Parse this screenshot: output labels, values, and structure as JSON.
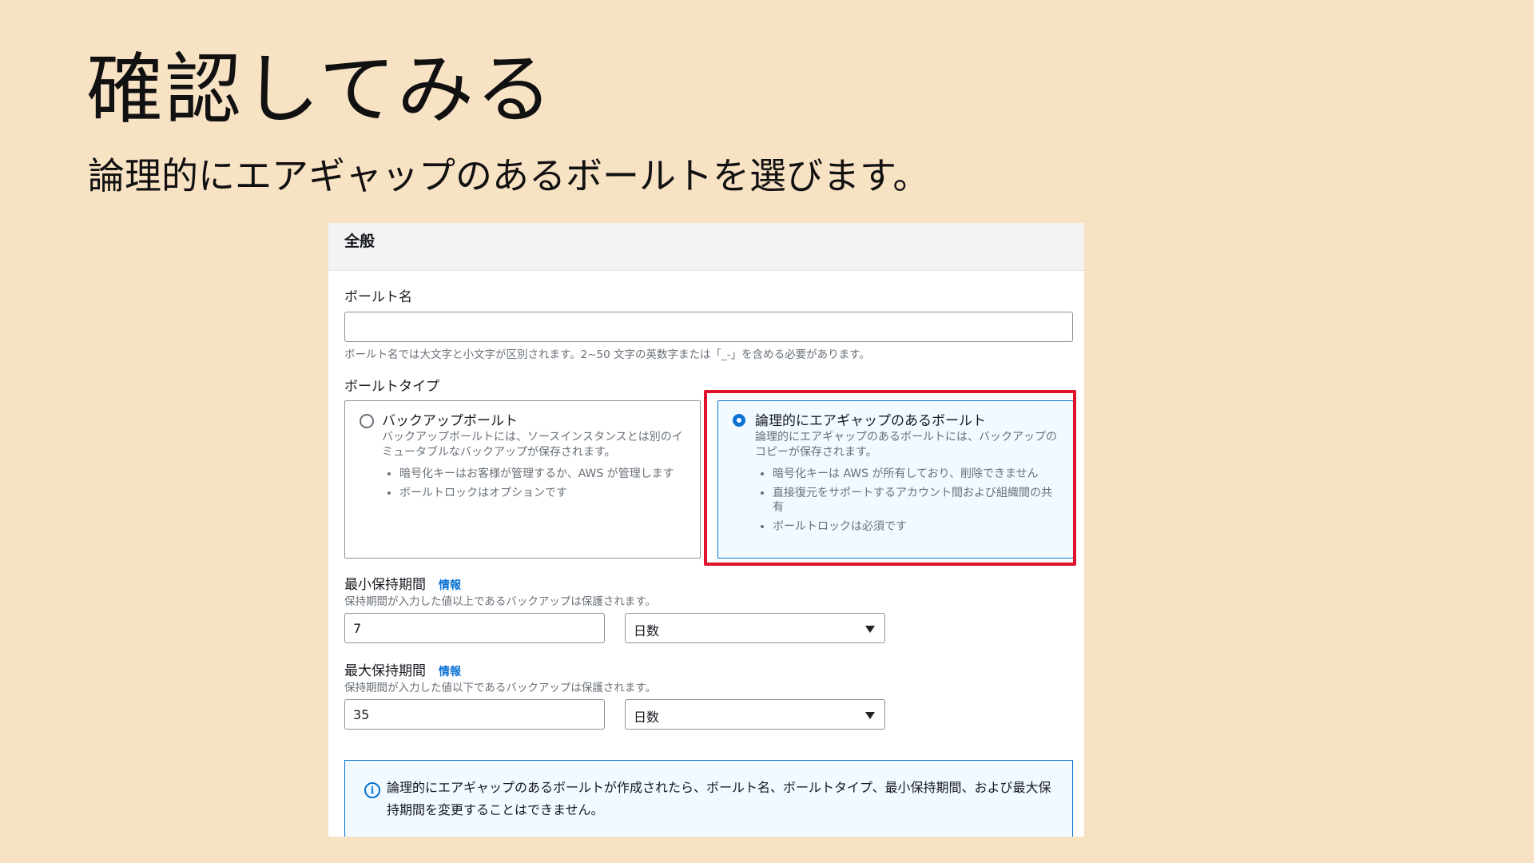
{
  "slide": {
    "title": "確認してみる",
    "subtitle": "論理的にエアギャップのあるボールトを選びます。"
  },
  "panel": {
    "header": "全般",
    "vault_name": {
      "label": "ボールト名",
      "value": "",
      "hint": "ボールト名では大文字と小文字が区別されます。2~50 文字の英数字または「_-」を含める必要があります。"
    },
    "vault_type": {
      "label": "ボールトタイプ",
      "options": [
        {
          "title": "バックアップボールト",
          "description": "バックアップボールトには、ソースインスタンスとは別のイミュータブルなバックアップが保存されます。",
          "bullets": [
            "暗号化キーはお客様が管理するか、AWS が管理します",
            "ボールトロックはオプションです"
          ],
          "selected": false
        },
        {
          "title": "論理的にエアギャップのあるボールト",
          "description": "論理的にエアギャップのあるボールトには、バックアップのコピーが保存されます。",
          "bullets": [
            "暗号化キーは AWS が所有しており、削除できません",
            "直接復元をサポートするアカウント間および組織間の共有",
            "ボールトロックは必須です"
          ],
          "selected": true
        }
      ]
    },
    "min_retention": {
      "label": "最小保持期間",
      "info": "情報",
      "hint": "保持期間が入力した値以上であるバックアップは保護されます。",
      "value": "7",
      "unit": "日数"
    },
    "max_retention": {
      "label": "最大保持期間",
      "info": "情報",
      "hint": "保持期間が入力した値以下であるバックアップは保護されます。",
      "value": "35",
      "unit": "日数"
    },
    "alert": {
      "message": "論理的にエアギャップのあるボールトが作成されたら、ボールト名、ボールトタイプ、最小保持期間、および最大保持期間を変更することはできません。"
    }
  },
  "colors": {
    "background": "#f8e2c4",
    "highlight": "#e0112a",
    "accent": "#0972d3"
  }
}
